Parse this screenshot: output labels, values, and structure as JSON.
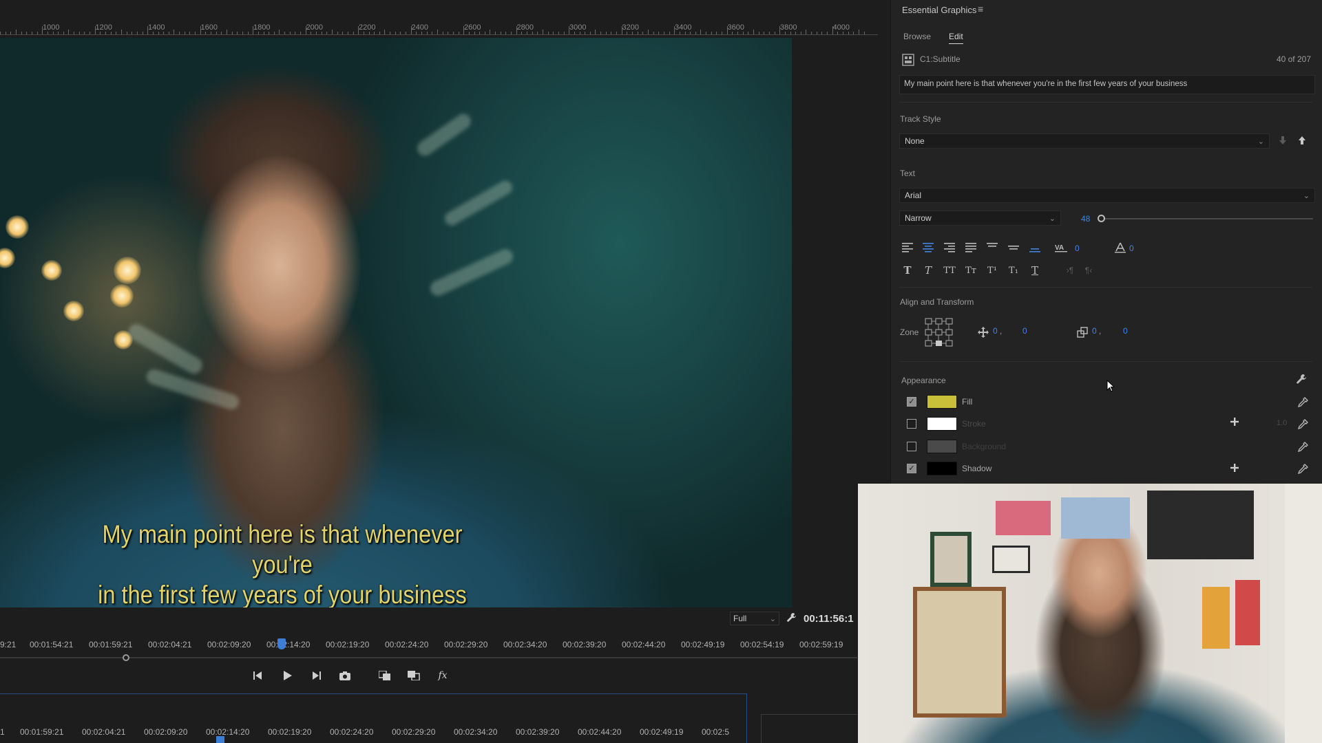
{
  "ruler": {
    "labels": [
      "1000",
      "1200",
      "1400",
      "1600",
      "1800",
      "2000",
      "2200",
      "2400",
      "2600",
      "2800",
      "3000",
      "3200",
      "3400",
      "3600",
      "3800",
      "4000"
    ]
  },
  "video": {
    "subtitle_line1": "My main point here is that whenever you're",
    "subtitle_line2": "in the first few years of your business"
  },
  "monitor_controls": {
    "quality": "Full",
    "timecode": "00:11:56:1"
  },
  "mini_timeline": {
    "timecodes": [
      "9:21",
      "00:01:54:21",
      "00:01:59:21",
      "00:02:04:21",
      "00:02:09:20",
      "00:02:14:20",
      "00:02:19:20",
      "00:02:24:20",
      "00:02:29:20",
      "00:02:34:20",
      "00:02:39:20",
      "00:02:44:20",
      "00:02:49:19",
      "00:02:54:19",
      "00:02:59:19"
    ]
  },
  "transport": {
    "step_back": "⏮",
    "play": "▶",
    "step_forward": "⏭",
    "export_frame": "📷",
    "insert": "⧉",
    "overwrite": "⧉",
    "fx": "fx"
  },
  "timeline": {
    "timecodes": [
      "1",
      "00:01:59:21",
      "00:02:04:21",
      "00:02:09:20",
      "00:02:14:20",
      "00:02:19:20",
      "00:02:24:20",
      "00:02:29:20",
      "00:02:34:20",
      "00:02:39:20",
      "00:02:44:20",
      "00:02:49:19",
      "00:02:5"
    ]
  },
  "panel": {
    "title": "Essential Graphics",
    "menu": "≡",
    "tabs": [
      "Browse",
      "Edit"
    ],
    "caption_track": "C1:Subtitle",
    "caption_count": "40 of 207",
    "caption_text": "My main point here is that whenever you're in the first few years of your business",
    "track_style": {
      "label": "Track Style",
      "value": "None"
    },
    "text": {
      "label": "Text",
      "font": "Arial",
      "style": "Narrow",
      "size": "48",
      "tracking": "0",
      "leading": "0",
      "size_fraction": 0
    },
    "align": {
      "label": "Align and Transform",
      "zone": "Zone",
      "pos_x": "0",
      "pos_y": "0",
      "size_x": "0",
      "size_y": "0"
    },
    "appearance": {
      "label": "Appearance",
      "rows": [
        {
          "label": "Fill",
          "checked": true,
          "color": "#c9c03a"
        },
        {
          "label": "Stroke",
          "checked": false,
          "color": "#ffffff",
          "value": "1.0"
        },
        {
          "label": "Background",
          "checked": false,
          "color": "#4a4a4a"
        },
        {
          "label": "Shadow",
          "checked": true,
          "color": "#000000"
        }
      ]
    }
  },
  "colors": {
    "accent_blue": "#3f86e0",
    "subtitle_yellow": "#e2d36a"
  }
}
